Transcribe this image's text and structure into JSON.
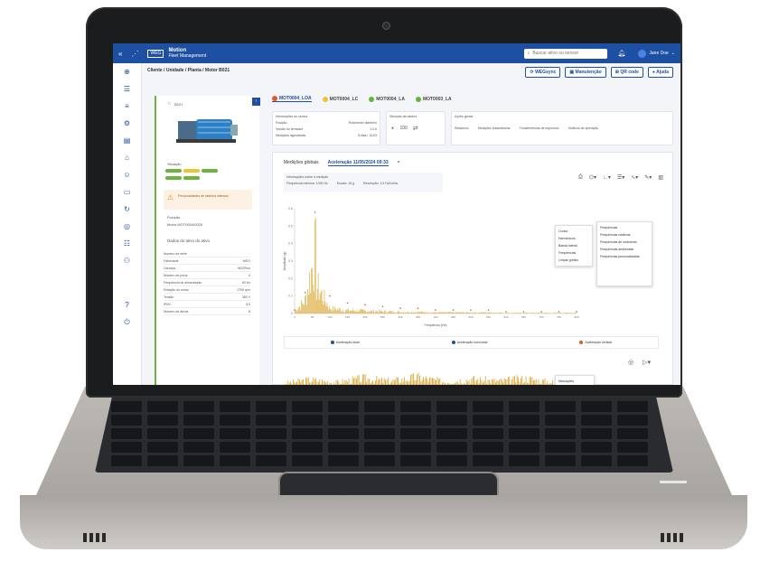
{
  "topbar": {
    "app_name": "Motion",
    "app_subtitle": "Fleet Management",
    "logo_text": "WEG",
    "search_placeholder": "Buscar ativo ou sensor",
    "user_name": "Jane Doe"
  },
  "breadcrumb": "Cliente / Unidade / Planta / Motor B021",
  "actions": {
    "sync": "WEGsync",
    "maintenance": "Manutenção",
    "qrcode": "QR code",
    "help": "Ajuda"
  },
  "asset_tabs": [
    {
      "label": "MOT0004_LOA",
      "color": "#e4572e"
    },
    {
      "label": "MOT0004_LC",
      "color": "#f2c230"
    },
    {
      "label": "MOT0004_LA",
      "color": "#69b33f"
    },
    {
      "label": "MOT0003_LA",
      "color": "#69b33f"
    }
  ],
  "left_panel": {
    "tag": "B021",
    "status_title": "Situação",
    "alert_title": "Personalidades de sistema alterado",
    "location_title": "Posição",
    "location_value": "Motor MOT0004/0020",
    "props_title": "Dados do ativo do ativo",
    "props": [
      {
        "k": "Número de série",
        "v": "-"
      },
      {
        "k": "Fabricante",
        "v": "WEG"
      },
      {
        "k": "Carcaça",
        "v": "W22Plus"
      },
      {
        "k": "Número de polos",
        "v": "4"
      },
      {
        "k": "Frequência de alimentação",
        "v": "60 Hz"
      },
      {
        "k": "Rotação do motor",
        "v": "1750 rpm"
      },
      {
        "k": "Tensão",
        "v": "380 V"
      },
      {
        "k": "IP/IN",
        "v": "5,5"
      },
      {
        "k": "Número de ativos",
        "v": "8"
      }
    ]
  },
  "info_cards": {
    "sensor_title": "Informações do sensor",
    "sensor_rows": [
      "Posição",
      "Versão do firmware",
      "Medições agendadas"
    ],
    "sensor_vals": [
      "Rolamento dianteiro",
      "1.0.6",
      "5 dias / 10:03"
    ],
    "battery_title": "Situação da bateria",
    "battery_value": "100",
    "actions_title": "Ações gerais",
    "actions": [
      "Relatórios",
      "Medições instantâneas",
      "Transferências de espectros",
      "Gráficos de operação"
    ]
  },
  "subtabs": {
    "overall": "Medições globais",
    "accel": "Aceleração 11/05/2024 09:33"
  },
  "measure_info": {
    "title": "Informações sobre a medição",
    "freq": "Frequência máxima: 1000 Hz",
    "scale": "Escala: 16 g",
    "resolution": "Resolução: 1,5 Hz/Linha"
  },
  "context_menu": [
    "Cursor",
    "Harmônicos",
    "Banda lateral",
    "Frequências",
    "Limpar gráfico"
  ],
  "freq_panel": {
    "title": "Frequências",
    "items": [
      "Frequências rotativas",
      "Frequências de rolamento",
      "Frequências ambientais",
      "Frequências personalizadas"
    ]
  },
  "legend": [
    {
      "label": "Aceleração axial",
      "color": "#1d4fa3"
    },
    {
      "label": "Aceleração horizontal",
      "color": "#1d4fa3"
    },
    {
      "label": "Aceleração vertical",
      "color": "#e4572e"
    }
  ],
  "lower_menu": [
    "Marcações",
    "Limpar gráfico"
  ],
  "axis": {
    "freq_label": "Frequência (Hz)",
    "amp_label": "Amplitude (g)",
    "freq_ticks": [
      "0",
      "50",
      "100",
      "150",
      "200",
      "250",
      "300",
      "350",
      "400",
      "450",
      "500",
      "550",
      "600",
      "650",
      "700",
      "750",
      "800"
    ],
    "amp_ticks": [
      "0.6",
      "0.5",
      "0.4",
      "0.3",
      "0.2",
      "0.1",
      "0"
    ]
  },
  "chart_data": [
    {
      "type": "line",
      "xlabel": "Frequência (Hz)",
      "ylabel": "Amplitude (g)",
      "x": [
        0,
        30,
        58,
        100,
        150,
        200,
        250,
        300,
        350,
        400,
        450,
        500,
        550,
        600,
        650,
        700,
        750,
        800
      ],
      "series": [
        {
          "name": "Aceleração vertical",
          "values": [
            0.02,
            0.12,
            0.58,
            0.1,
            0.06,
            0.05,
            0.04,
            0.03,
            0.03,
            0.02,
            0.02,
            0.02,
            0.02,
            0.01,
            0.01,
            0.01,
            0.01,
            0.01
          ]
        }
      ],
      "ylim": [
        0,
        0.6
      ]
    },
    {
      "type": "line",
      "xlabel": "Tempo (s)",
      "ylabel": "Amplitude (g)",
      "x": [
        0,
        1,
        2,
        3,
        4,
        5,
        6,
        7,
        8,
        9,
        10
      ],
      "series": [
        {
          "name": "Aceleração vertical",
          "values": [
            0.3,
            0.6,
            0.4,
            0.7,
            0.5,
            0.8,
            0.45,
            0.65,
            0.5,
            0.7,
            0.4
          ]
        }
      ]
    }
  ]
}
